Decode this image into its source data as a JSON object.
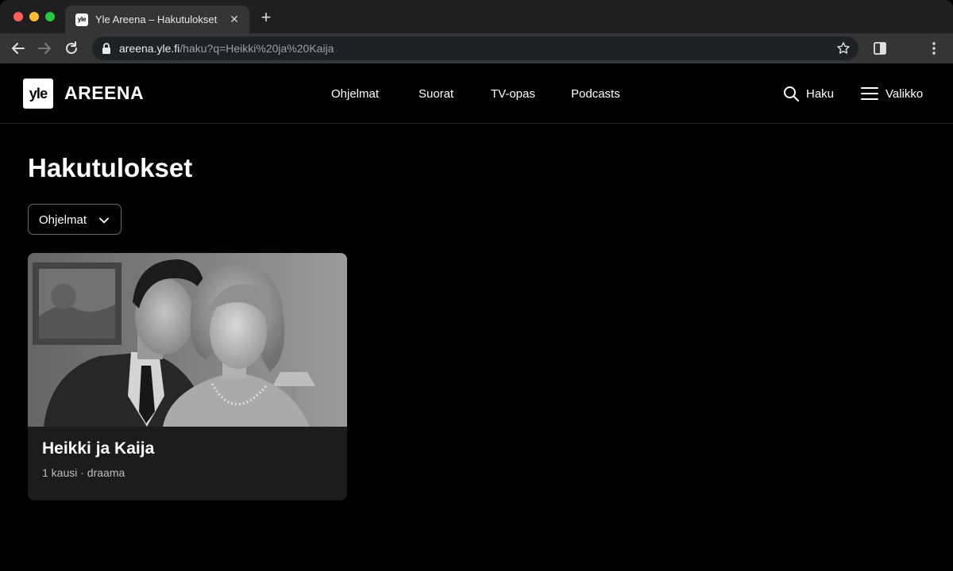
{
  "browser": {
    "tab_title": "Yle Areena – Hakutulokset",
    "tab_favicon_text": "yle",
    "url_host": "areena.yle.fi",
    "url_path": "/haku?q=Heikki%20ja%20Kaija"
  },
  "header": {
    "logo_text": "yle",
    "brand": "AREENA",
    "nav": [
      "Ohjelmat",
      "Suorat",
      "TV-opas",
      "Podcasts"
    ],
    "search_label": "Haku",
    "menu_label": "Valikko"
  },
  "main": {
    "title": "Hakutulokset",
    "filter_label": "Ohjelmat",
    "results": [
      {
        "title": "Heikki ja Kaija",
        "meta": "1 kausi · draama"
      }
    ]
  },
  "colors": {
    "background": "#000000",
    "chrome_dark": "#1f1f20",
    "chrome_toolbar": "#353536",
    "card_background": "#1c1c1d",
    "meta_text": "#bdbdbd"
  },
  "icons": {
    "search": "search-icon",
    "menu": "hamburger-menu-icon",
    "filter_chevron": "chevron-down-icon"
  }
}
